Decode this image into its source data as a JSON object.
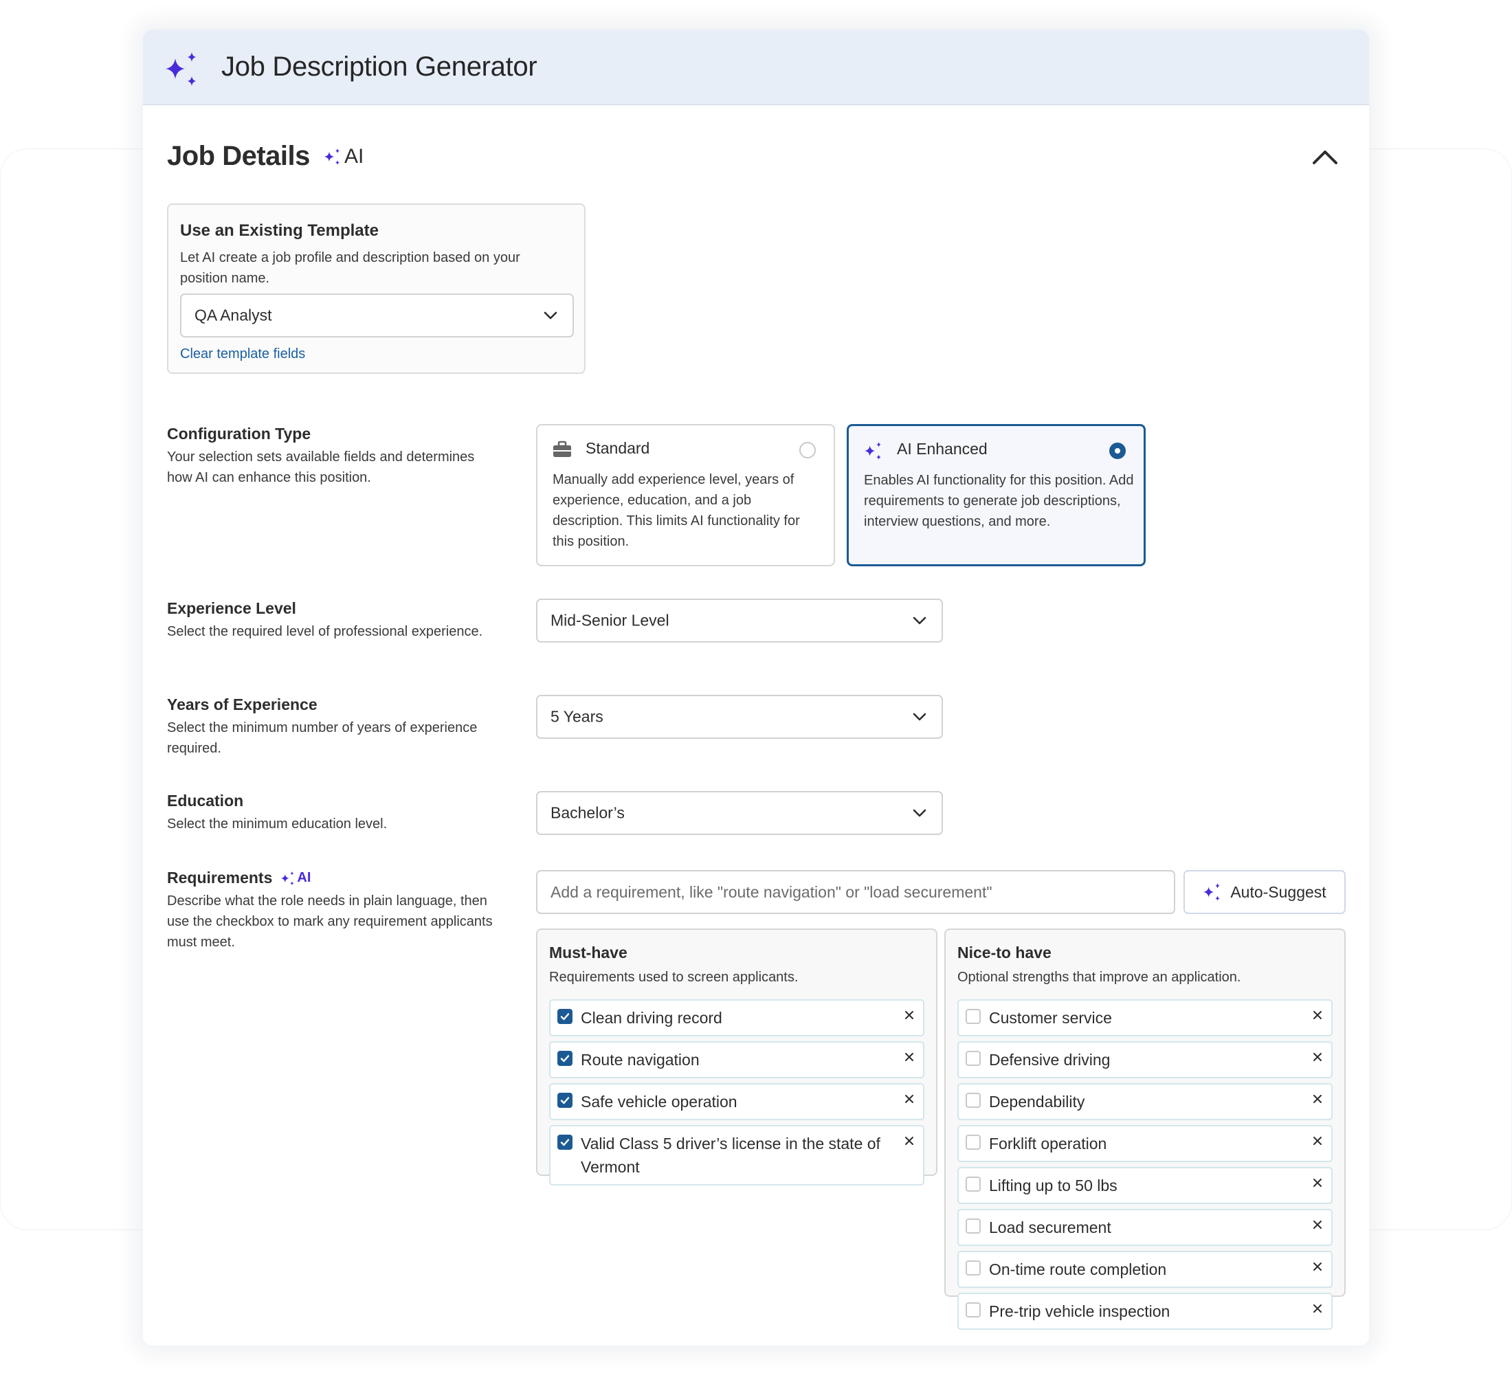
{
  "header": {
    "title": "Job Description Generator"
  },
  "section": {
    "title": "Job Details",
    "ai_label": "AI"
  },
  "template": {
    "heading": "Use an Existing Template",
    "description": "Let AI create a job profile and description based on your position name.",
    "selected": "QA Analyst",
    "clear_link": "Clear template fields"
  },
  "config": {
    "label": "Configuration Type",
    "description": "Your selection sets available fields and determines how AI can enhance this position.",
    "options": [
      {
        "title": "Standard",
        "description": "Manually add experience level, years of experience, education, and a job description. This limits AI functionality for this position.",
        "selected": false
      },
      {
        "title": "AI Enhanced",
        "description": "Enables AI functionality for this position. Add requirements to generate job descriptions, interview questions, and more.",
        "selected": true
      }
    ]
  },
  "experience": {
    "label": "Experience Level",
    "description": "Select the required level of professional experience.",
    "value": "Mid-Senior Level"
  },
  "years": {
    "label": "Years of Experience",
    "description": "Select the minimum number of years of experience required.",
    "value": "5 Years"
  },
  "education": {
    "label": "Education",
    "description": "Select the minimum education level.",
    "value": "Bachelor’s"
  },
  "requirements": {
    "label": "Requirements",
    "ai_label": "AI",
    "description": "Describe what the role needs in plain language, then use the checkbox to mark any requirement applicants must meet.",
    "input_placeholder": "Add a requirement, like \"route navigation\" or \"load securement\"",
    "auto_suggest": "Auto-Suggest",
    "must_have": {
      "heading": "Must-have",
      "description": "Requirements used to screen applicants.",
      "items": [
        {
          "label": "Clean driving record",
          "checked": true
        },
        {
          "label": "Route navigation",
          "checked": true
        },
        {
          "label": "Safe vehicle operation",
          "checked": true
        },
        {
          "label": "Valid Class 5 driver’s license in the state of Vermont",
          "checked": true
        }
      ]
    },
    "nice_to_have": {
      "heading": "Nice-to have",
      "description": "Optional strengths that improve an application.",
      "items": [
        {
          "label": "Customer service",
          "checked": false
        },
        {
          "label": "Defensive driving",
          "checked": false
        },
        {
          "label": "Dependability",
          "checked": false
        },
        {
          "label": "Forklift operation",
          "checked": false
        },
        {
          "label": "Lifting up to 50 lbs",
          "checked": false
        },
        {
          "label": "Load securement",
          "checked": false
        },
        {
          "label": "On-time route completion",
          "checked": false
        },
        {
          "label": "Pre-trip vehicle inspection",
          "checked": false
        }
      ]
    }
  },
  "colors": {
    "accent": "#1c5a94",
    "ai": "#4a2bd9",
    "link": "#1a5fa3",
    "header_bg": "#e8eef8"
  },
  "icons": {
    "logo": "sparkle-icon",
    "collapse": "chevron-up-icon",
    "standard": "briefcase-icon",
    "ai": "sparkle-icon",
    "dropdown": "chevron-down-icon",
    "remove": "close-icon"
  }
}
